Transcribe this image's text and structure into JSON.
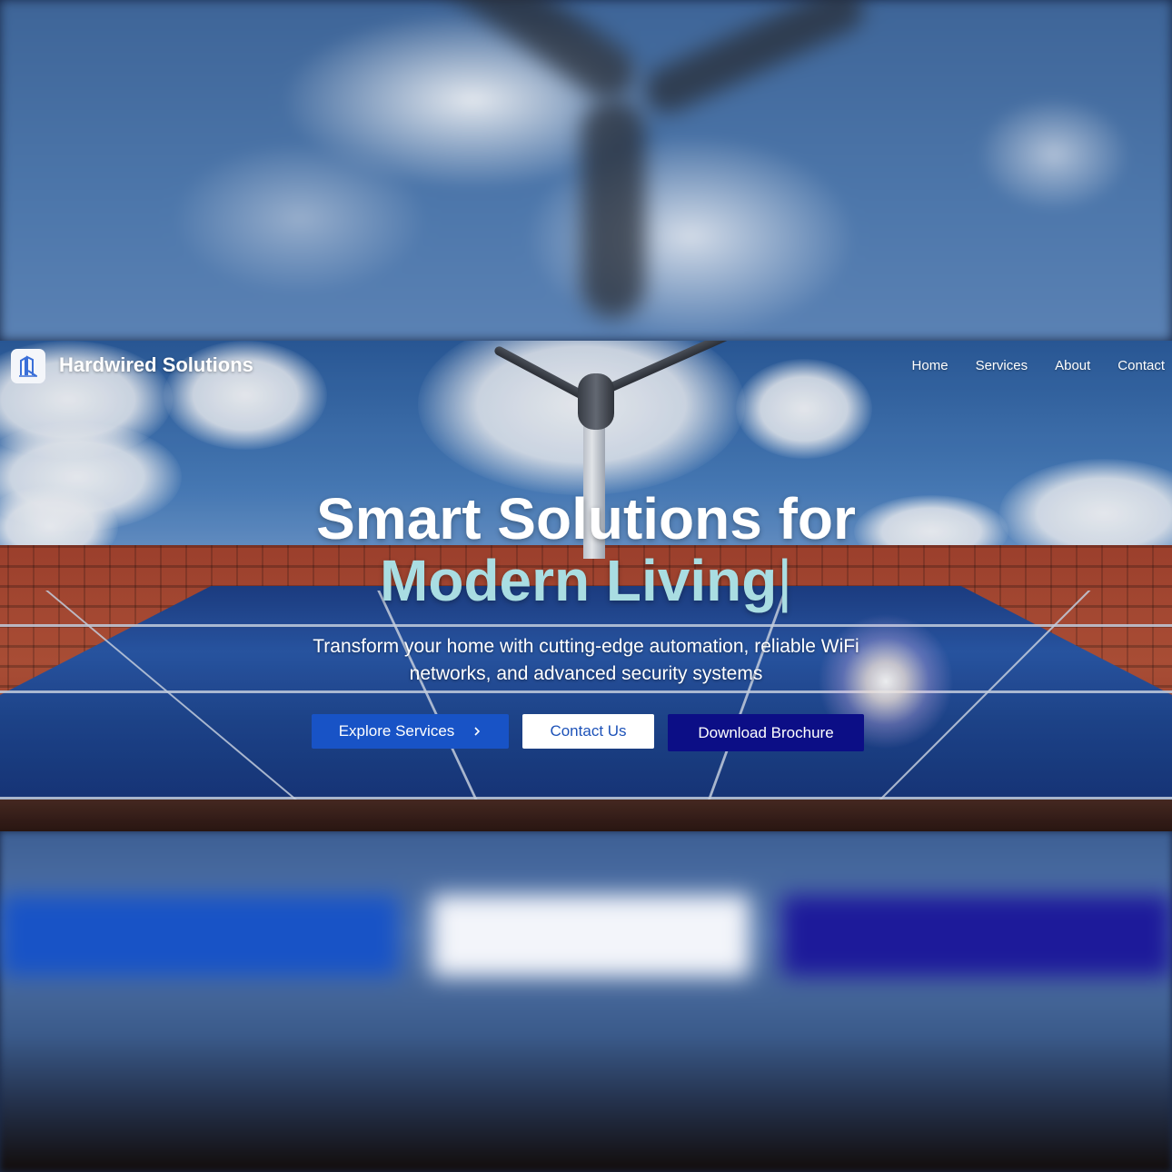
{
  "brand": {
    "name": "Hardwired Solutions",
    "logo_icon": "building-icon"
  },
  "nav": {
    "items": [
      {
        "label": "Home"
      },
      {
        "label": "Services"
      },
      {
        "label": "About"
      },
      {
        "label": "Contact"
      }
    ]
  },
  "hero": {
    "headline_line1": "Smart Solutions for",
    "headline_line2": "Modern Living",
    "cursor": "|",
    "subtitle": "Transform your home with cutting-edge automation, reliable WiFi networks, and advanced security systems",
    "buttons": {
      "explore": "Explore Services",
      "explore_icon": "chevron-right-icon",
      "contact": "Contact Us",
      "download": "Download Brochure"
    }
  },
  "colors": {
    "accent_text": "#a9dde2",
    "primary_button": "#1853c6",
    "download_button": "#0c0e86",
    "contact_text": "#1d52b8"
  }
}
